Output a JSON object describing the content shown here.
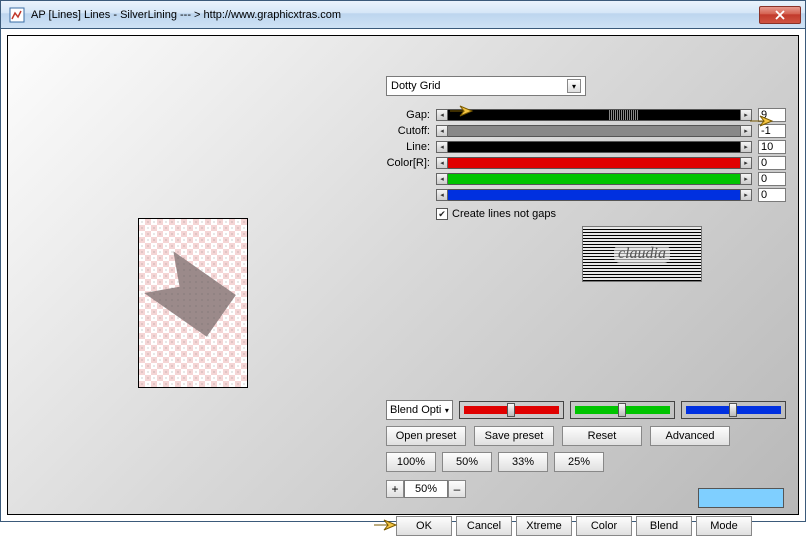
{
  "window": {
    "title": "AP [Lines]  Lines - SilverLining    --- >  http://www.graphicxtras.com"
  },
  "preset_dropdown": {
    "selected": "Dotty Grid"
  },
  "sliders": {
    "gap": {
      "label": "Gap:",
      "value": "9"
    },
    "cutoff": {
      "label": "Cutoff:",
      "value": "-1"
    },
    "line": {
      "label": "Line:",
      "value": "10"
    },
    "colorR": {
      "label": "Color[R]:",
      "value": "0"
    },
    "colorG": {
      "label": "",
      "value": "0"
    },
    "colorB": {
      "label": "",
      "value": "0"
    }
  },
  "checkbox": {
    "label": "Create lines not gaps",
    "checked": true
  },
  "logo_text": "claudia",
  "blend_select": "Blend Opti",
  "preset_buttons": {
    "open": "Open preset",
    "save": "Save preset",
    "reset": "Reset",
    "advanced": "Advanced"
  },
  "percent_buttons": {
    "p100": "100%",
    "p50": "50%",
    "p33": "33%",
    "p25": "25%"
  },
  "zoom": {
    "value": "50%",
    "plus": "+",
    "minus": "–"
  },
  "final": {
    "ok": "OK",
    "cancel": "Cancel",
    "xtreme": "Xtreme",
    "color": "Color",
    "blend": "Blend",
    "mode": "Mode"
  },
  "swatch_color": "#7fcfff"
}
